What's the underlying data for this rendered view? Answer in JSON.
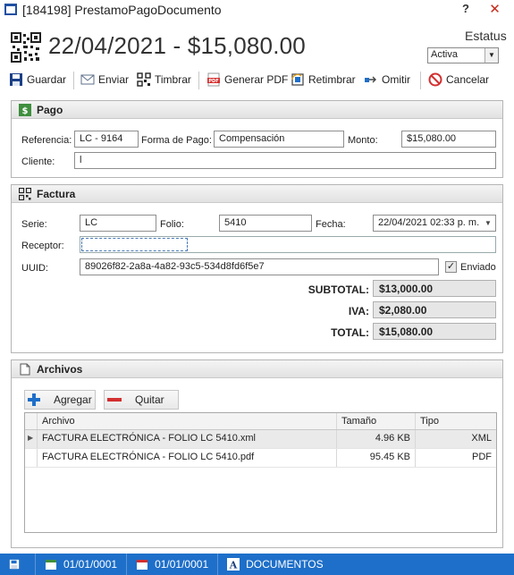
{
  "window": {
    "title": "[184198] PrestamoPagoDocumento",
    "help_label": "?",
    "close_label": "✕"
  },
  "header": {
    "headline": "22/04/2021 - $15,080.00",
    "status_label": "Estatus",
    "status_value": "Activa"
  },
  "toolbar": {
    "save": "Guardar",
    "send": "Enviar",
    "stamp": "Timbrar",
    "pdf": "Generar PDF",
    "restamp": "Retimbrar",
    "skip": "Omitir",
    "cancel": "Cancelar"
  },
  "pago": {
    "title": "Pago",
    "referencia_label": "Referencia:",
    "referencia_value": "LC - 9164",
    "forma_label": "Forma de Pago:",
    "forma_value": "Compensación",
    "monto_label": "Monto:",
    "monto_value": "$15,080.00",
    "cliente_label": "Cliente:",
    "cliente_value": "l"
  },
  "factura": {
    "title": "Factura",
    "serie_label": "Serie:",
    "serie_value": "LC",
    "folio_label": "Folio:",
    "folio_value": "5410",
    "fecha_label": "Fecha:",
    "fecha_value": "22/04/2021 02:33 p. m.",
    "receptor_label": "Receptor:",
    "receptor_value": "",
    "uuid_label": "UUID:",
    "uuid_value": "89026f82-2a8a-4a82-93c5-534d8fd6f5e7",
    "enviado_label": "Enviado",
    "enviado_checked": true,
    "subtotal_label": "SUBTOTAL:",
    "subtotal_value": "$13,000.00",
    "iva_label": "IVA:",
    "iva_value": "$2,080.00",
    "total_label": "TOTAL:",
    "total_value": "$15,080.00"
  },
  "archivos": {
    "title": "Archivos",
    "add_label": "Agregar",
    "remove_label": "Quitar",
    "columns": [
      "Archivo",
      "Tamaño",
      "Tipo"
    ],
    "rows": [
      {
        "archivo": "FACTURA ELECTRÓNICA - FOLIO LC 5410.xml",
        "tamano": "4.96 KB",
        "tipo": "XML"
      },
      {
        "archivo": "FACTURA ELECTRÓNICA - FOLIO LC 5410.pdf",
        "tamano": "95.45 KB",
        "tipo": "PDF"
      }
    ]
  },
  "statusbar": {
    "date1": "01/01/0001",
    "date2": "01/01/0001",
    "documents": "DOCUMENTOS"
  },
  "colors": {
    "statusbar_bg": "#1e6fc9",
    "close_icon": "#c42b1c"
  }
}
